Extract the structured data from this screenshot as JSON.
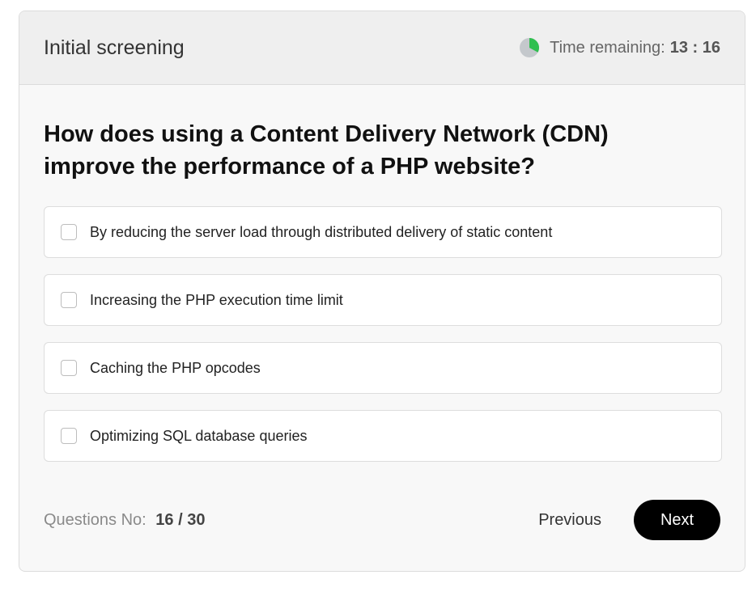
{
  "header": {
    "title": "Initial screening",
    "timer_label": "Time remaining:",
    "timer_value": "13 : 16",
    "timer_icon": "pie-timer-icon",
    "timer_progress_fraction": 0.33
  },
  "question": {
    "text": "How does using a Content Delivery Network (CDN) improve the performance of a PHP website?"
  },
  "options": [
    {
      "label": "By reducing the server load through distributed delivery of static content",
      "checked": false
    },
    {
      "label": "Increasing the PHP execution time limit",
      "checked": false
    },
    {
      "label": "Caching the PHP opcodes",
      "checked": false
    },
    {
      "label": "Optimizing SQL database queries",
      "checked": false
    }
  ],
  "footer": {
    "questions_label": "Questions No:",
    "questions_value": "16 / 30",
    "previous_label": "Previous",
    "next_label": "Next"
  },
  "colors": {
    "timer_fill": "#2fbf4f",
    "timer_track": "#c4c8cc",
    "next_bg": "#000000"
  }
}
